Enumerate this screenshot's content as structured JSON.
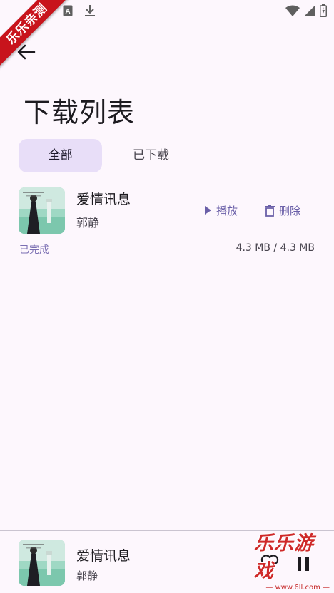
{
  "watermark": {
    "ribbon_text": "乐乐亲测",
    "logo_text": "乐乐游戏",
    "logo_url": "— www.6ll.com —"
  },
  "status_bar": {
    "icons": [
      "sim-card-a-icon",
      "download-icon",
      "wifi-icon",
      "signal-icon",
      "battery-icon"
    ]
  },
  "header": {
    "title": "下载列表"
  },
  "tabs": [
    {
      "label": "全部",
      "selected": true
    },
    {
      "label": "已下载",
      "selected": false
    }
  ],
  "downloads": [
    {
      "title": "爱情讯息",
      "artist": "郭静",
      "play_label": "播放",
      "delete_label": "删除",
      "status": "已完成",
      "size": "4.3 MB / 4.3 MB"
    }
  ],
  "player": {
    "title": "爱情讯息",
    "artist": "郭静"
  },
  "colors": {
    "background": "#fdf7fd",
    "accent": "#6a5fa8",
    "tab_selected": "#e8def8",
    "watermark_red": "#c8141c"
  }
}
